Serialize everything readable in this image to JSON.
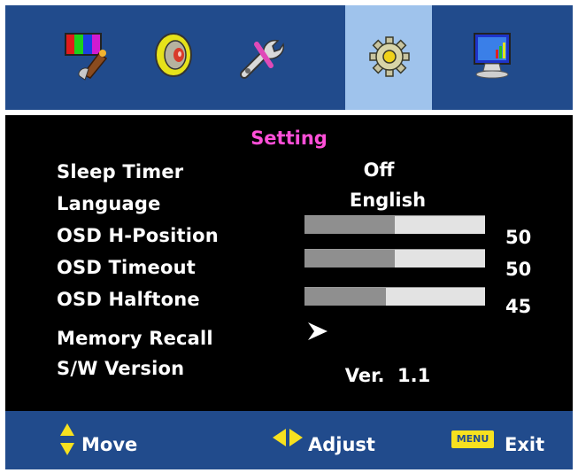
{
  "tabs": [
    {
      "icon": "picture-icon",
      "active": false
    },
    {
      "icon": "sound-speaker-icon",
      "active": false
    },
    {
      "icon": "tools-wrench-icon",
      "active": false
    },
    {
      "icon": "settings-gear-icon",
      "active": true
    },
    {
      "icon": "monitor-icon",
      "active": false
    }
  ],
  "colors": {
    "panel_blue": "#214b8c",
    "active_tab": "#9fc3ec",
    "title_pink": "#ff4fd8",
    "bar_fill": "#8f8f8f",
    "bar_track": "#e3e3e3",
    "key_yellow": "#f7e11f"
  },
  "content": {
    "title": "Setting",
    "items": {
      "sleep_timer": {
        "label": "Sleep Timer",
        "value": "Off"
      },
      "language": {
        "label": "Language",
        "value": "English"
      },
      "osd_h_position": {
        "label": "OSD H-Position",
        "value": "50",
        "level": 0.5
      },
      "osd_timeout": {
        "label": "OSD Timeout",
        "value": "50",
        "level": 0.5
      },
      "osd_halftone": {
        "label": "OSD Halftone",
        "value": "45",
        "level": 0.45
      },
      "memory_recall": {
        "label": "Memory Recall",
        "icon": "arrow-right-icon"
      },
      "sw_version": {
        "label": "S/W Version",
        "value": "Ver.  1.1"
      }
    }
  },
  "footer": {
    "move": {
      "label": "Move",
      "icon": "up-down-arrows-icon"
    },
    "adjust": {
      "label": "Adjust",
      "icon": "left-right-arrows-icon"
    },
    "exit": {
      "label": "Exit",
      "key": "MENU"
    }
  }
}
